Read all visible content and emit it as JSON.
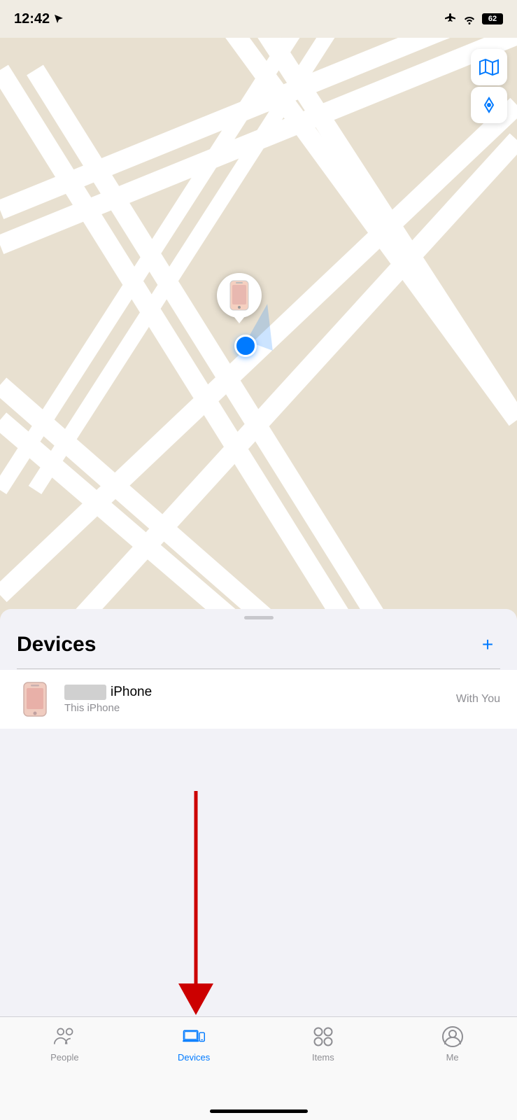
{
  "status_bar": {
    "time": "12:42",
    "battery": "62"
  },
  "map_controls": {
    "map_btn": "🗺",
    "location_btn": "➤"
  },
  "sheet": {
    "title": "Devices",
    "add_btn": "+",
    "drag_hint": ""
  },
  "device": {
    "name_suffix": "iPhone",
    "subtitle": "This iPhone",
    "status": "With You"
  },
  "tab_bar": {
    "tabs": [
      {
        "id": "people",
        "label": "People",
        "active": false
      },
      {
        "id": "devices",
        "label": "Devices",
        "active": true
      },
      {
        "id": "items",
        "label": "Items",
        "active": false
      },
      {
        "id": "me",
        "label": "Me",
        "active": false
      }
    ]
  },
  "colors": {
    "accent": "#007AFF",
    "inactive_tab": "#8e8e93",
    "map_bg": "#e8e0d0",
    "road": "#ffffff",
    "sheet_bg": "#f2f2f7"
  }
}
